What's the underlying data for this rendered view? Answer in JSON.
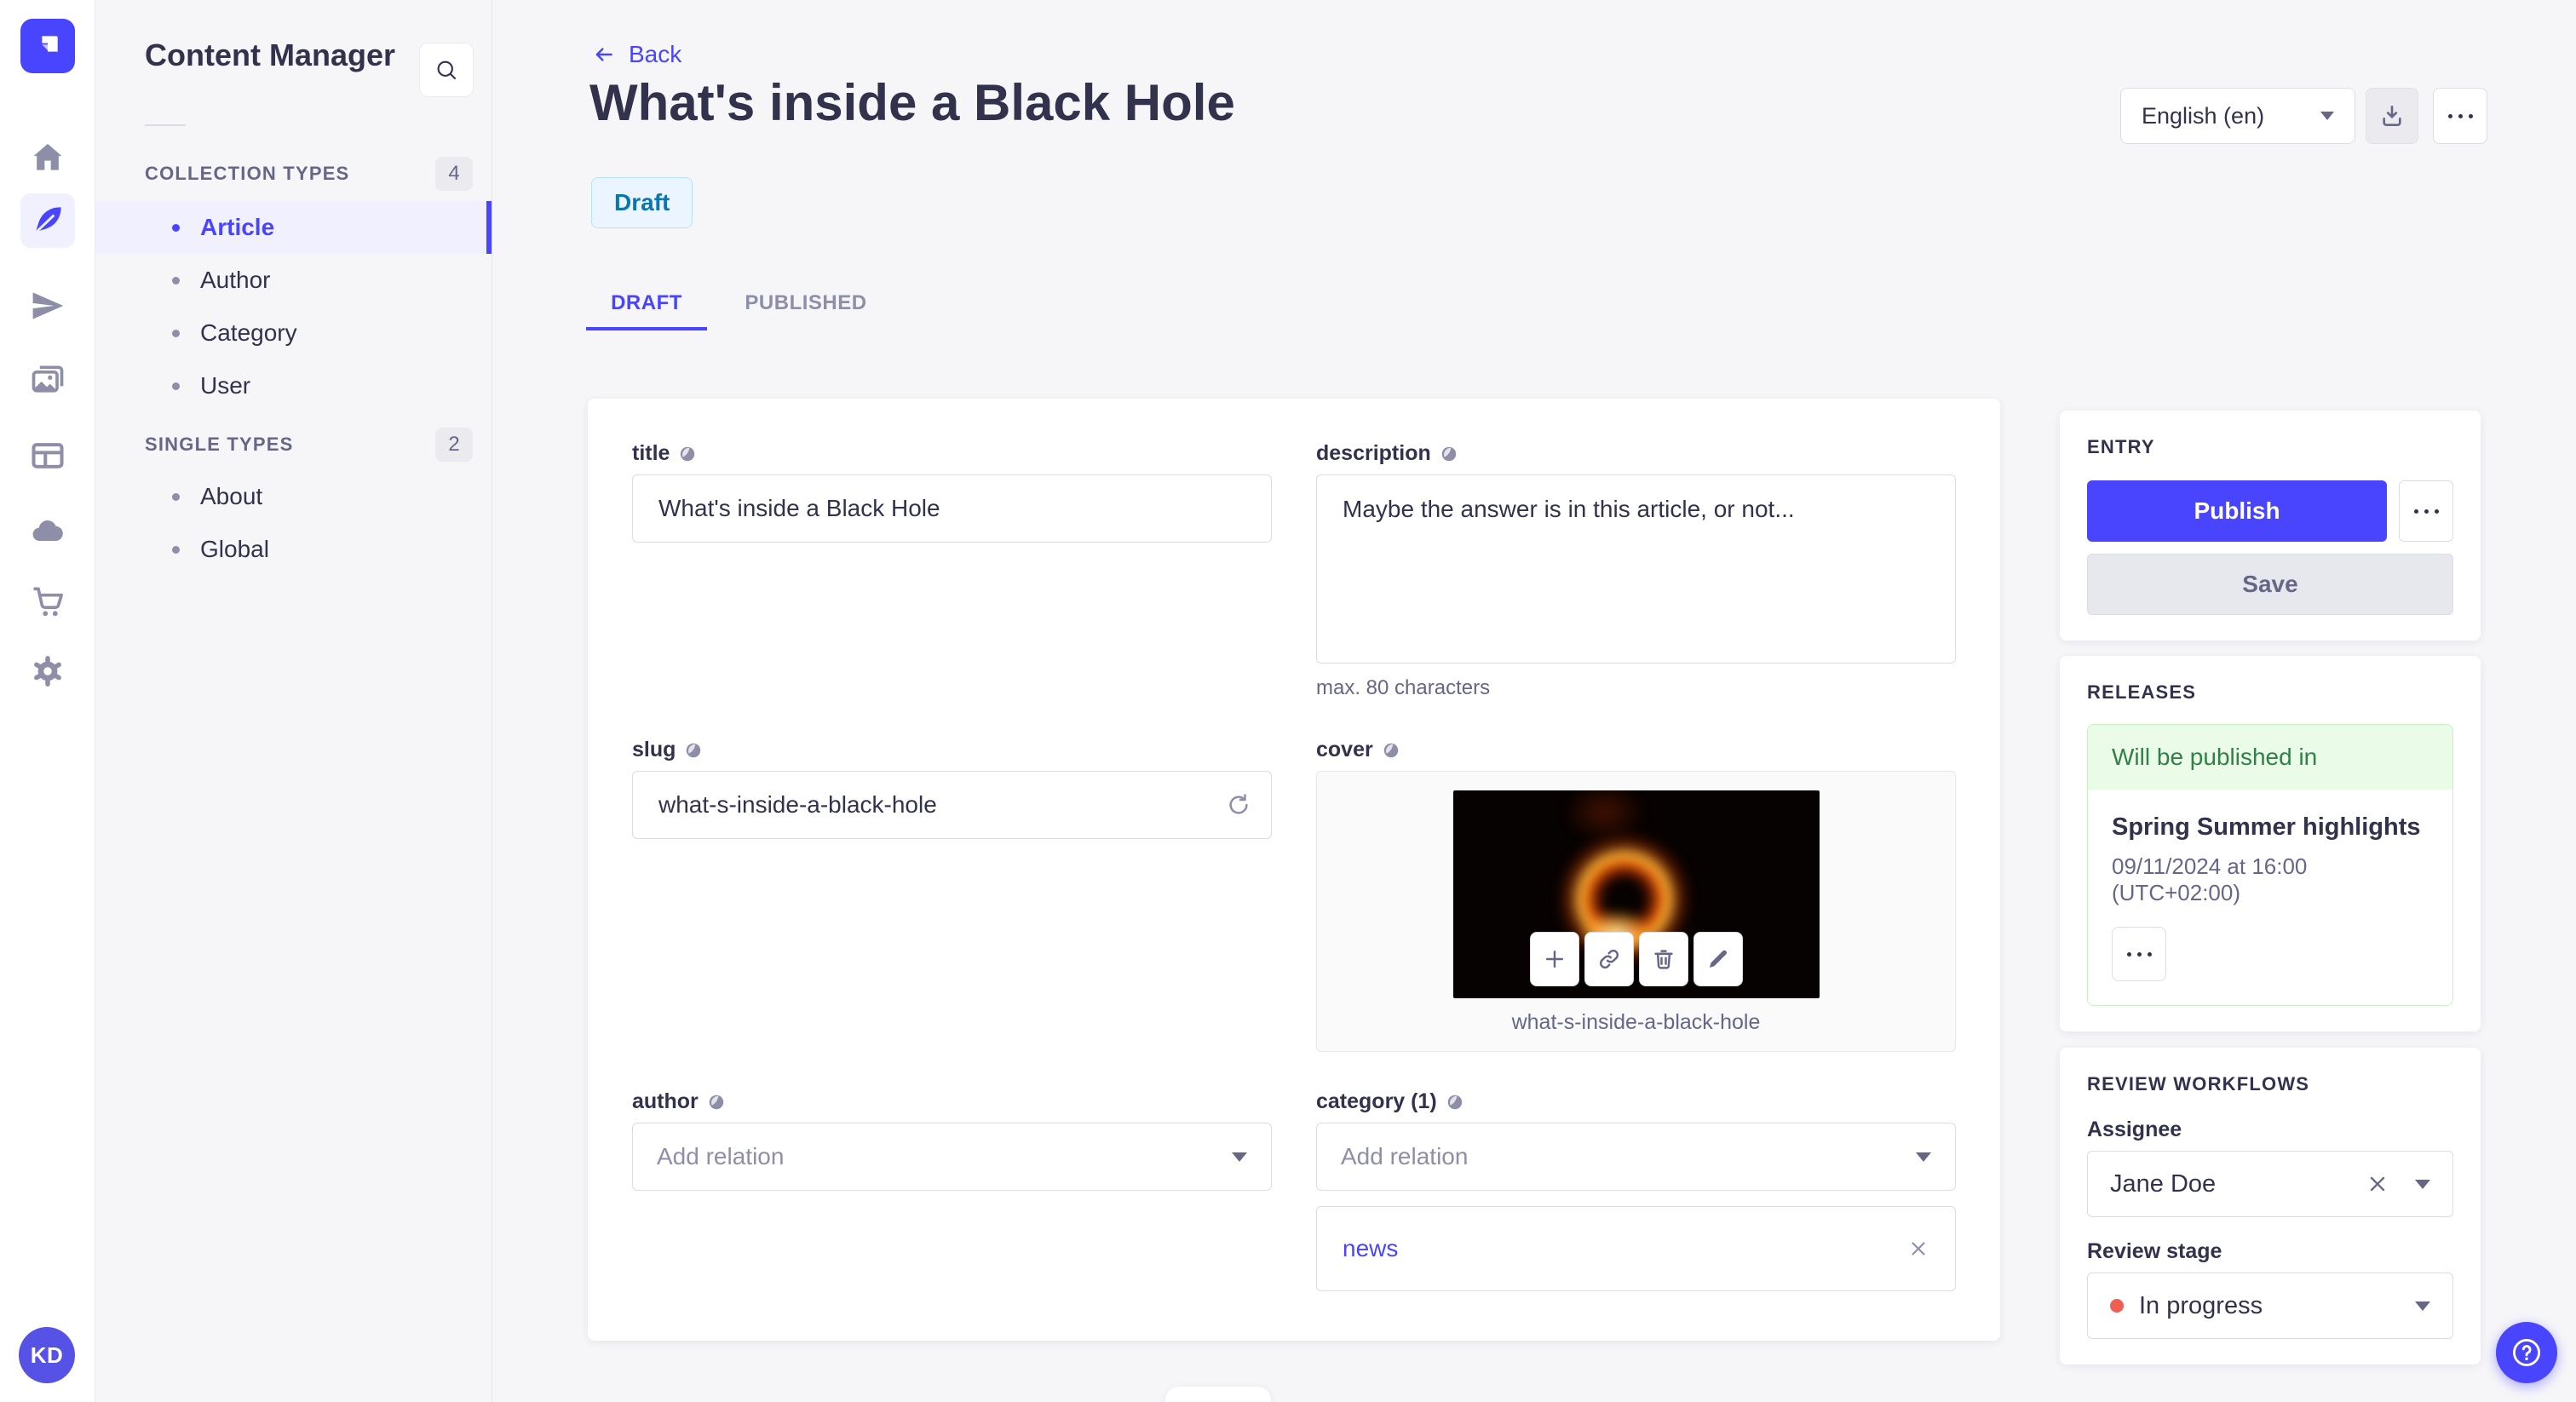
{
  "colors": {
    "accent": "#4945ff",
    "accent_light_bg": "#f0f0ff",
    "draft_badge_bg": "#eaf5ff",
    "draft_badge_text": "#0c75af",
    "release_green_bg": "#eafbe7",
    "release_green_text": "#328048",
    "stage_dot_red": "#ee5e52",
    "page_bg": "#f6f6f9"
  },
  "rail": {
    "icons": [
      "home-icon",
      "feather-icon",
      "paper-plane-icon",
      "media-library-icon",
      "layout-icon",
      "cloud-icon",
      "cart-icon",
      "gear-icon"
    ],
    "active_icon": "feather-icon",
    "avatar_initials": "KD"
  },
  "subnav": {
    "title": "Content Manager",
    "sections": [
      {
        "label": "COLLECTION TYPES",
        "count": "4",
        "items": [
          {
            "label": "Article",
            "active": true
          },
          {
            "label": "Author",
            "active": false
          },
          {
            "label": "Category",
            "active": false
          },
          {
            "label": "User",
            "active": false
          }
        ]
      },
      {
        "label": "SINGLE TYPES",
        "count": "2",
        "items": [
          {
            "label": "About",
            "active": false
          },
          {
            "label": "Global",
            "active": false
          }
        ]
      }
    ]
  },
  "header": {
    "back_label": "Back",
    "title": "What's inside a Black Hole",
    "status_badge": "Draft",
    "locale": "English (en)",
    "tabs": [
      {
        "label": "DRAFT",
        "active": true
      },
      {
        "label": "PUBLISHED",
        "active": false
      }
    ]
  },
  "form": {
    "title": {
      "label": "title",
      "value": "What's inside a Black Hole"
    },
    "description": {
      "label": "description",
      "value": "Maybe the answer is in this article, or not...",
      "helper": "max. 80 characters"
    },
    "slug": {
      "label": "slug",
      "value": "what-s-inside-a-black-hole"
    },
    "cover": {
      "label": "cover",
      "caption": "what-s-inside-a-black-hole"
    },
    "author": {
      "label": "author",
      "placeholder": "Add relation"
    },
    "category": {
      "label": "category (1)",
      "placeholder": "Add relation",
      "relations": [
        {
          "label": "news"
        }
      ]
    }
  },
  "entry_panel": {
    "heading": "ENTRY",
    "publish_label": "Publish",
    "save_label": "Save"
  },
  "releases_panel": {
    "heading": "RELEASES",
    "status": "Will be published in",
    "release_title": "Spring Summer highlights",
    "release_date": "09/11/2024 at 16:00 (UTC+02:00)"
  },
  "review_panel": {
    "heading": "REVIEW WORKFLOWS",
    "assignee_label": "Assignee",
    "assignee_value": "Jane Doe",
    "stage_label": "Review stage",
    "stage_value": "In progress"
  }
}
